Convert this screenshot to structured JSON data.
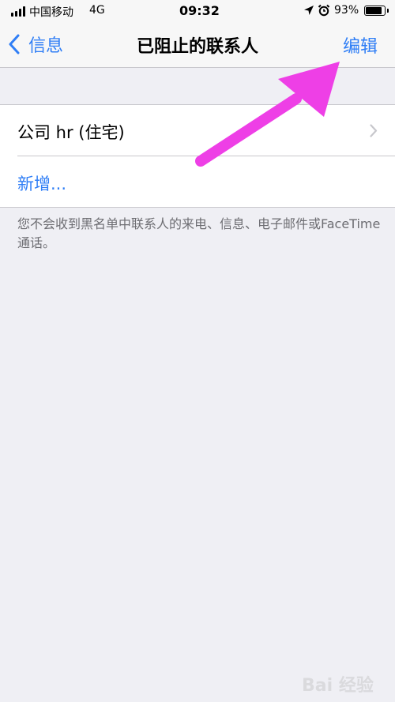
{
  "status_bar": {
    "carrier": "中国移动",
    "network": "4G",
    "time": "09:32",
    "battery_percent": "93%",
    "battery_level": 0.93,
    "icons": [
      "signal-icon",
      "location-icon",
      "alarm-icon",
      "battery-icon"
    ]
  },
  "nav": {
    "back_label": "信息",
    "title": "已阻止的联系人",
    "edit_label": "编辑"
  },
  "list": {
    "items": [
      {
        "label": "公司 hr (住宅)"
      },
      {
        "label": "新增..."
      }
    ]
  },
  "footer": {
    "note": "您不会收到黑名单中联系人的来电、信息、电子邮件或FaceTime通话。"
  },
  "watermark": {
    "text": "Bai 经验"
  },
  "colors": {
    "accent": "#2f7ef6",
    "background": "#efeff4",
    "annotation": "#ee3fe6"
  }
}
